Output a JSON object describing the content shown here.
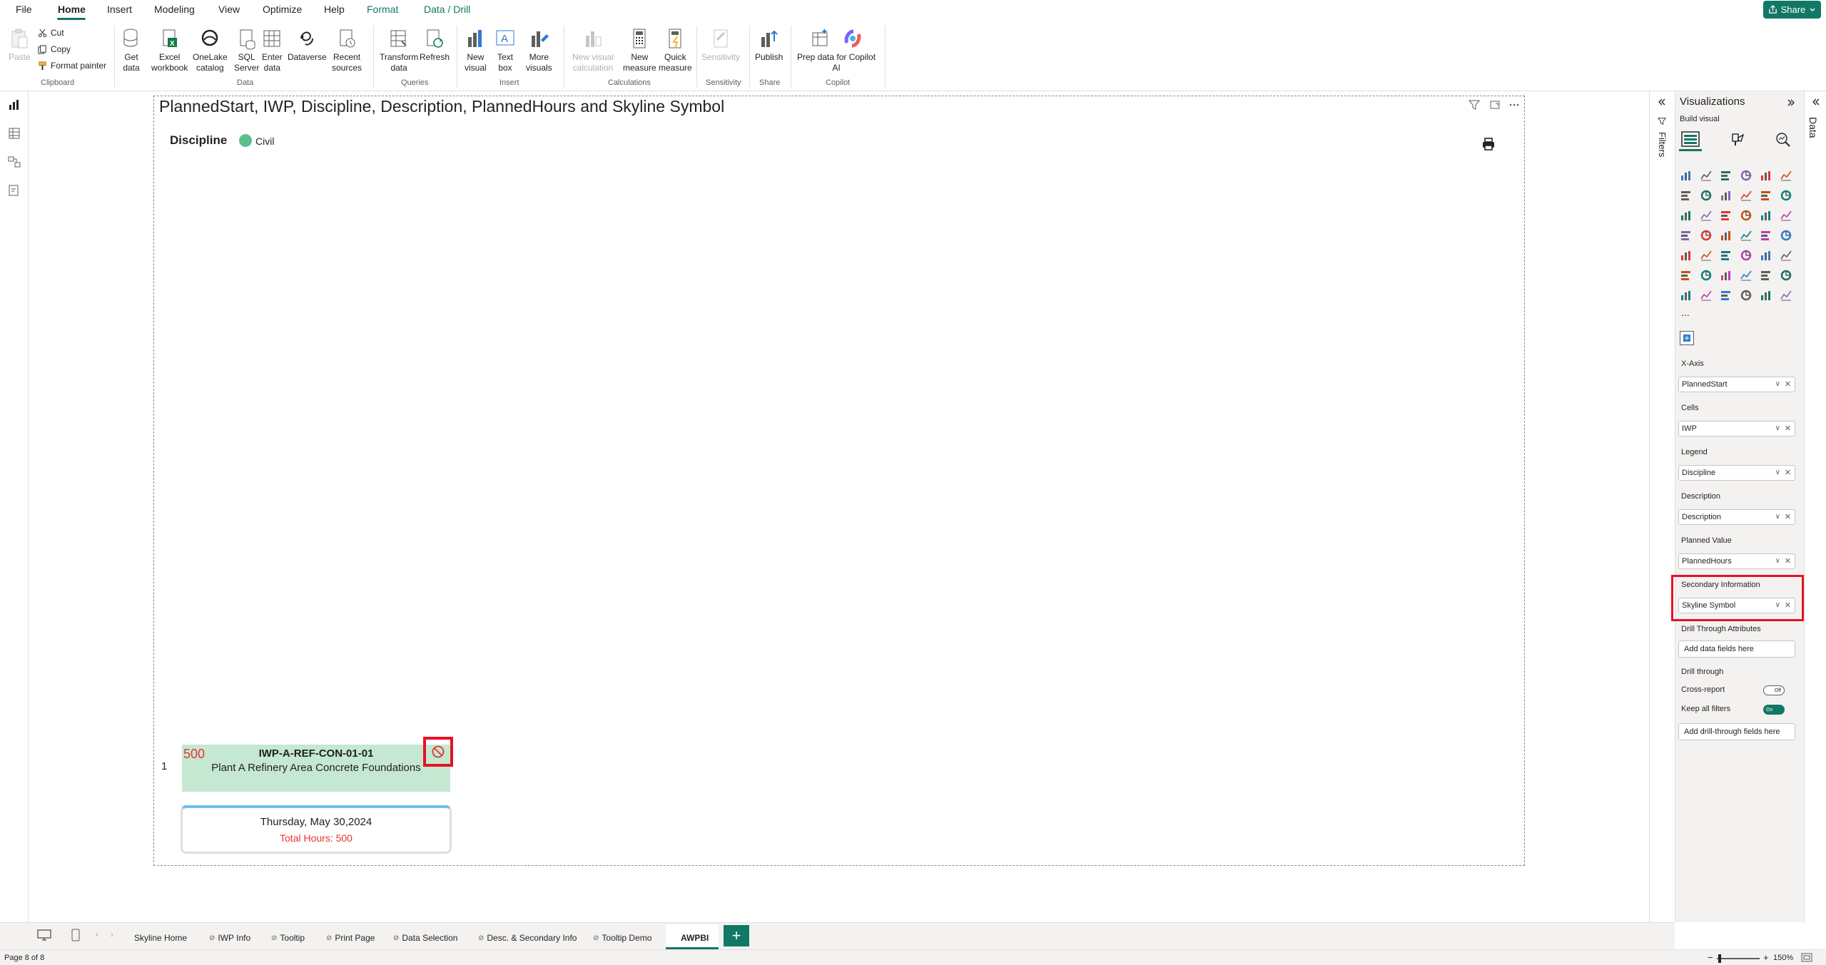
{
  "menu": {
    "items": [
      "File",
      "Home",
      "Insert",
      "Modeling",
      "View",
      "Optimize",
      "Help",
      "Format",
      "Data / Drill"
    ],
    "share": "Share"
  },
  "ribbon": {
    "paste": "Paste",
    "cut": "Cut",
    "copy": "Copy",
    "format_painter": "Format painter",
    "clipboard": "Clipboard",
    "get_data": [
      "Get",
      "data"
    ],
    "excel": [
      "Excel",
      "workbook"
    ],
    "onelake": [
      "OneLake",
      "catalog"
    ],
    "sql": [
      "SQL",
      "Server"
    ],
    "enter_data": [
      "Enter",
      "data"
    ],
    "dataverse": "Dataverse",
    "recent": [
      "Recent",
      "sources"
    ],
    "data_group": "Data",
    "transform": [
      "Transform",
      "data"
    ],
    "refresh": "Refresh",
    "queries_group": "Queries",
    "new_visual": [
      "New",
      "visual"
    ],
    "text_box": [
      "Text",
      "box"
    ],
    "more_visuals": [
      "More",
      "visuals"
    ],
    "insert_group": "Insert",
    "new_visual_calc": [
      "New visual",
      "calculation"
    ],
    "new_measure": [
      "New",
      "measure"
    ],
    "quick_measure": [
      "Quick",
      "measure"
    ],
    "calculations_group": "Calculations",
    "sensitivity": "Sensitivity",
    "sensitivity_group": "Sensitivity",
    "publish": "Publish",
    "share_group": "Share",
    "copilot": [
      "Prep data for Copilot",
      "AI"
    ],
    "copilot_group": "Copilot"
  },
  "visual": {
    "title": "PlannedStart, IWP, Discipline, Description, PlannedHours and Skyline Symbol",
    "legend_title": "Discipline",
    "legend_item": "Civil",
    "row_number": "1",
    "card_value": "500",
    "card_name": "IWP-A-REF-CON-01-01",
    "card_description": "Plant A Refinery Area Concrete Foundations",
    "date": "Thursday, May 30,2024",
    "total_hours": "Total Hours: 500"
  },
  "filters_label": "Filters",
  "data_label": "Data",
  "viz_pane": {
    "title": "Visualizations",
    "build_visual": "Build visual",
    "more": "...",
    "fields": [
      {
        "label": "X-Axis",
        "value": "PlannedStart"
      },
      {
        "label": "Cells",
        "value": "IWP"
      },
      {
        "label": "Legend",
        "value": "Discipline"
      },
      {
        "label": "Description",
        "value": "Description"
      },
      {
        "label": "Planned Value",
        "value": "PlannedHours"
      },
      {
        "label": "Secondary Information",
        "value": "Skyline Symbol"
      }
    ],
    "drill_through_attrs": "Drill Through Attributes",
    "add_data_fields": "Add data fields here",
    "drill_through": "Drill through",
    "cross_report": "Cross-report",
    "cross_report_state": "Off",
    "keep_all_filters": "Keep all filters",
    "keep_all_filters_state": "On",
    "add_drill_fields": "Add drill-through fields here"
  },
  "pages": {
    "tabs": [
      "Skyline Home",
      "IWP Info",
      "Tooltip",
      "Print Page",
      "Data Selection",
      "Desc. & Secondary Info",
      "Tooltip Demo",
      "AWPBI"
    ],
    "active": "AWPBI",
    "add": "+"
  },
  "status": {
    "page": "Page 8 of 8",
    "zoom": "150%",
    "zoom_minus": "−",
    "zoom_plus": "+"
  },
  "colors": {
    "accent": "#117865",
    "card_fill": "#c5e8d3",
    "highlight": "#e81123",
    "value_red": "#e8332f",
    "legend_civil": "#5bbf8c"
  }
}
